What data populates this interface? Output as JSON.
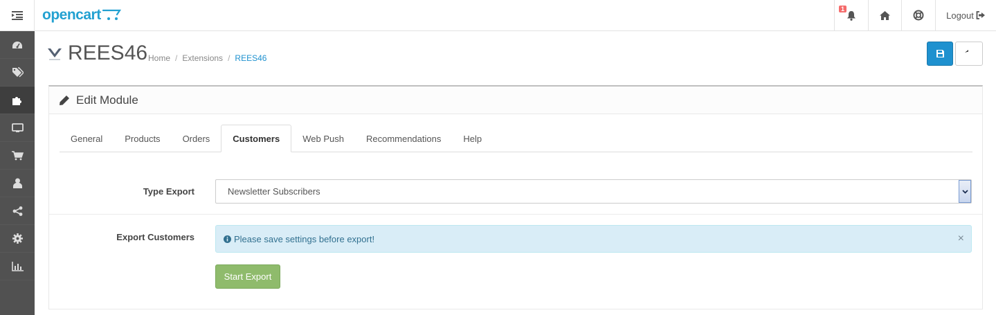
{
  "header": {
    "logo_text": "opencart",
    "notification_count": "1",
    "logout_label": "Logout"
  },
  "sidebar": {
    "items": [
      {
        "icon": "dashboard-icon"
      },
      {
        "icon": "catalog-tags-icon"
      },
      {
        "icon": "extensions-puzzle-icon",
        "active": true
      },
      {
        "icon": "design-monitor-icon"
      },
      {
        "icon": "sales-cart-icon"
      },
      {
        "icon": "customers-user-icon"
      },
      {
        "icon": "marketing-share-icon"
      },
      {
        "icon": "system-gear-icon"
      },
      {
        "icon": "reports-chart-icon"
      }
    ]
  },
  "page": {
    "title": "REES46",
    "breadcrumb": [
      "Home",
      "Extensions",
      "REES46"
    ],
    "breadcrumb_sep": "/"
  },
  "panel": {
    "title": "Edit Module",
    "tabs": [
      "General",
      "Products",
      "Orders",
      "Customers",
      "Web Push",
      "Recommendations",
      "Help"
    ],
    "active_tab": "Customers"
  },
  "form": {
    "type_export_label": "Type Export",
    "type_export_value": "Newsletter Subscribers",
    "export_customers_label": "Export Customers",
    "alert_text": "Please save settings before export!",
    "alert_close": "×",
    "start_export_label": "Start Export"
  },
  "colors": {
    "primary": "#1e91cf",
    "success": "#8fbb6c",
    "sidebar": "#515151",
    "info_bg": "#d9edf7"
  }
}
